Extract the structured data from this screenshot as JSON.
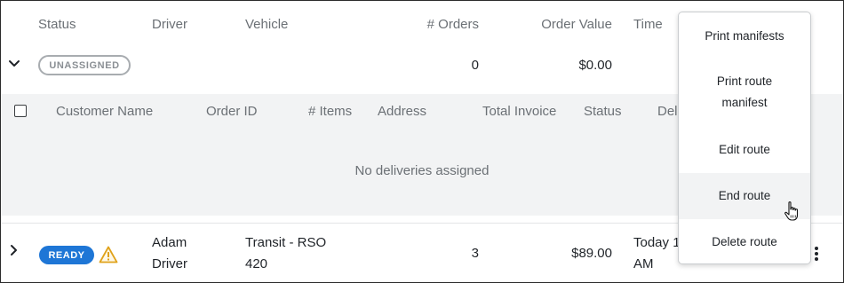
{
  "columns": {
    "status": "Status",
    "driver": "Driver",
    "vehicle": "Vehicle",
    "orders": "# Orders",
    "order_value": "Order Value",
    "time": "Time"
  },
  "unassigned_row": {
    "badge": "UNASSIGNED",
    "orders": "0",
    "order_value": "$0.00"
  },
  "deliveries_table": {
    "columns": {
      "customer_name": "Customer Name",
      "order_id": "Order ID",
      "items": "# Items",
      "address": "Address",
      "total_invoice": "Total Invoice",
      "status": "Status",
      "delivery_partial": "Del"
    },
    "empty_message": "No deliveries assigned"
  },
  "ready_row": {
    "badge": "READY",
    "driver_line1": "Adam",
    "driver_line2": "Driver",
    "vehicle_line1": "Transit - RSO",
    "vehicle_line2": "420",
    "orders": "3",
    "order_value": "$89.00",
    "time_line1": "Today 1",
    "time_line2": "AM"
  },
  "menu": {
    "print_manifests": "Print manifests",
    "print_route_manifest_line1": "Print route",
    "print_route_manifest_line2": "manifest",
    "edit_route": "Edit route",
    "end_route": "End route",
    "delete_route": "Delete route"
  },
  "icons": {
    "expand": "chevron-down-icon",
    "collapse": "chevron-right-icon",
    "warning": "warning-icon",
    "more": "kebab-menu-icon",
    "cursor": "hand-pointer-icon"
  },
  "colors": {
    "ready_badge": "#1e76d6",
    "warning": "#e0a21a",
    "unassigned_badge_border": "#a8acb0",
    "panel_bg": "#f2f3f4"
  }
}
